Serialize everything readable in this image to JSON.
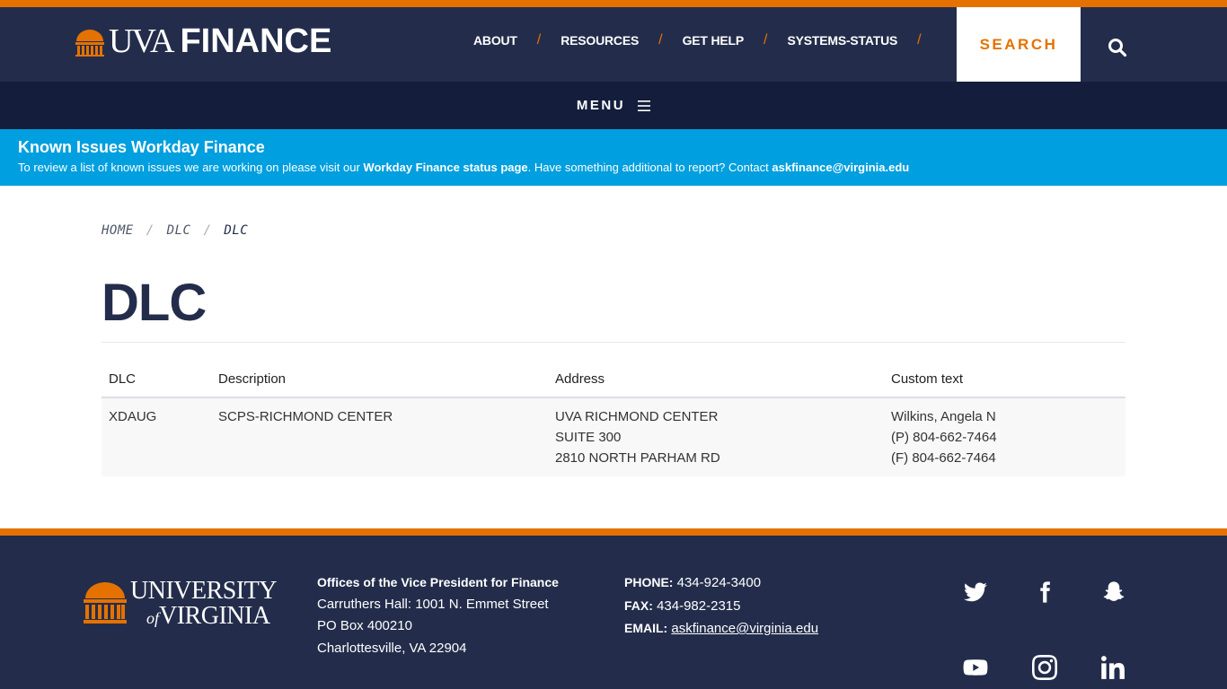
{
  "header": {
    "logo_uva": "UVA",
    "logo_finance": "FINANCE",
    "nav": [
      {
        "label": "ABOUT"
      },
      {
        "label": "RESOURCES"
      },
      {
        "label": "GET HELP"
      },
      {
        "label": "SYSTEMS-STATUS"
      }
    ],
    "nav_separator": "/",
    "search_label": "SEARCH",
    "menu_label": "MENU"
  },
  "alert": {
    "title": "Known Issues Workday Finance",
    "text_before": "To review a list of known issues we are working on please visit our ",
    "link": "Workday Finance status page",
    "text_middle": ".  Have something additional to report?  Contact ",
    "email": "askfinance@virginia.edu"
  },
  "breadcrumb": {
    "items": [
      "HOME",
      "DLC",
      "DLC"
    ],
    "separator": "/"
  },
  "page": {
    "title": "DLC"
  },
  "table": {
    "headers": [
      "DLC",
      "Description",
      "Address",
      "Custom text"
    ],
    "rows": [
      {
        "dlc": "XDAUG",
        "description": "SCPS-RICHMOND CENTER",
        "address": [
          "UVA RICHMOND CENTER",
          "SUITE 300",
          "2810 NORTH PARHAM RD"
        ],
        "custom": [
          "Wilkins, Angela N",
          "(P) 804-662-7464",
          "(F) 804-662-7464"
        ]
      }
    ]
  },
  "footer": {
    "logo_university": "UNIVERSITY",
    "logo_of": "of",
    "logo_virginia": "VIRGINIA",
    "org": "Offices of the Vice President for Finance",
    "address": [
      "Carruthers Hall: 1001 N. Emmet Street",
      "PO Box 400210",
      "Charlottesville, VA 22904"
    ],
    "phone_label": "PHONE:",
    "phone": "434-924-3400",
    "fax_label": "FAX:",
    "fax": "434-982-2315",
    "email_label": "EMAIL:",
    "email": "askfinance@virginia.edu",
    "social": [
      "twitter-icon",
      "facebook-icon",
      "snapchat-icon",
      "youtube-icon",
      "instagram-icon",
      "linkedin-icon"
    ]
  },
  "colors": {
    "navy": "#232d4b",
    "dark_navy": "#141e3c",
    "orange": "#e57200",
    "alert_blue": "#009fdf"
  }
}
